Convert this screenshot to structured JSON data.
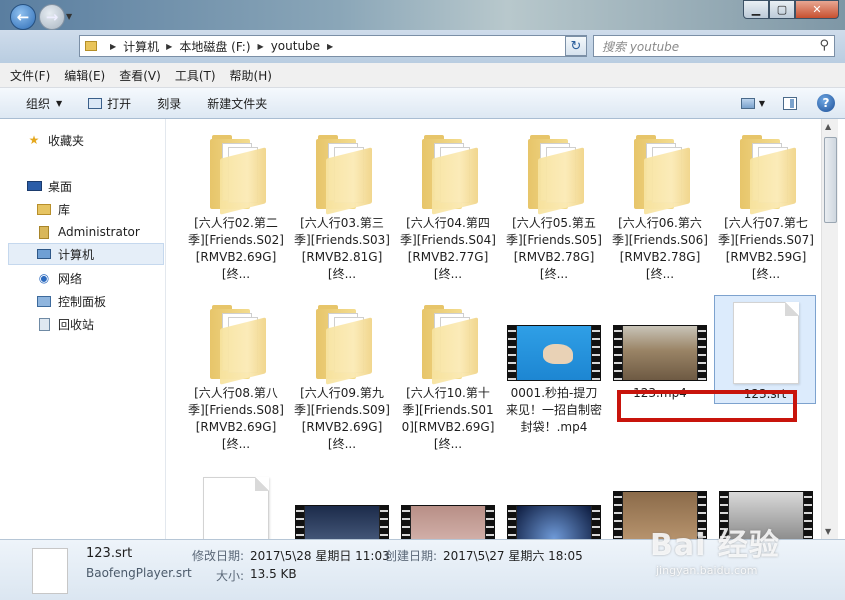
{
  "address": {
    "crumbs": [
      "计算机",
      "本地磁盘 (F:)",
      "youtube"
    ]
  },
  "search": {
    "placeholder": "搜索 youtube"
  },
  "menu": [
    "文件(F)",
    "编辑(E)",
    "查看(V)",
    "工具(T)",
    "帮助(H)"
  ],
  "toolbar": {
    "organize": "组织",
    "open": "打开",
    "burn": "刻录",
    "new_folder": "新建文件夹"
  },
  "nav": {
    "favorites": "收藏夹",
    "desktop": "桌面",
    "library": "库",
    "administrator": "Administrator",
    "computer": "计算机",
    "network": "网络",
    "control_panel": "控制面板",
    "recycle_bin": "回收站"
  },
  "files": [
    {
      "name": "[六人行02.第二季][Friends.S02][RMVB2.69G][终...",
      "kind": "folder"
    },
    {
      "name": "[六人行03.第三季][Friends.S03][RMVB2.81G][终...",
      "kind": "folder"
    },
    {
      "name": "[六人行04.第四季][Friends.S04][RMVB2.77G][终...",
      "kind": "folder"
    },
    {
      "name": "[六人行05.第五季][Friends.S05][RMVB2.78G][终...",
      "kind": "folder"
    },
    {
      "name": "[六人行06.第六季][Friends.S06][RMVB2.78G][终...",
      "kind": "folder"
    },
    {
      "name": "[六人行07.第七季][Friends.S07][RMVB2.59G][终...",
      "kind": "folder"
    },
    {
      "name": "[六人行08.第八季][Friends.S08][RMVB2.69G][终...",
      "kind": "folder"
    },
    {
      "name": "[六人行09.第九季][Friends.S09][RMVB2.69G][终...",
      "kind": "folder"
    },
    {
      "name": "[六人行10.第十季][Friends.S010][RMVB2.69G][终...",
      "kind": "folder"
    },
    {
      "name": "0001.秒拍-提刀来见！一招自制密封袋！.mp4",
      "kind": "video"
    },
    {
      "name": "123.mp4",
      "kind": "video"
    },
    {
      "name": "123.srt",
      "kind": "document"
    }
  ],
  "details": {
    "name": "123.srt",
    "app": "BaofengPlayer.srt",
    "modified_label": "修改日期:",
    "modified_value": "2017\\5\\28 星期日 11:03",
    "created_label": "创建日期:",
    "created_value": "2017\\5\\27 星期六 18:05",
    "size_label": "大小:",
    "size_value": "13.5 KB"
  },
  "watermark": {
    "main": "Bai 经验",
    "sub": "jingyan.baidu.com"
  }
}
